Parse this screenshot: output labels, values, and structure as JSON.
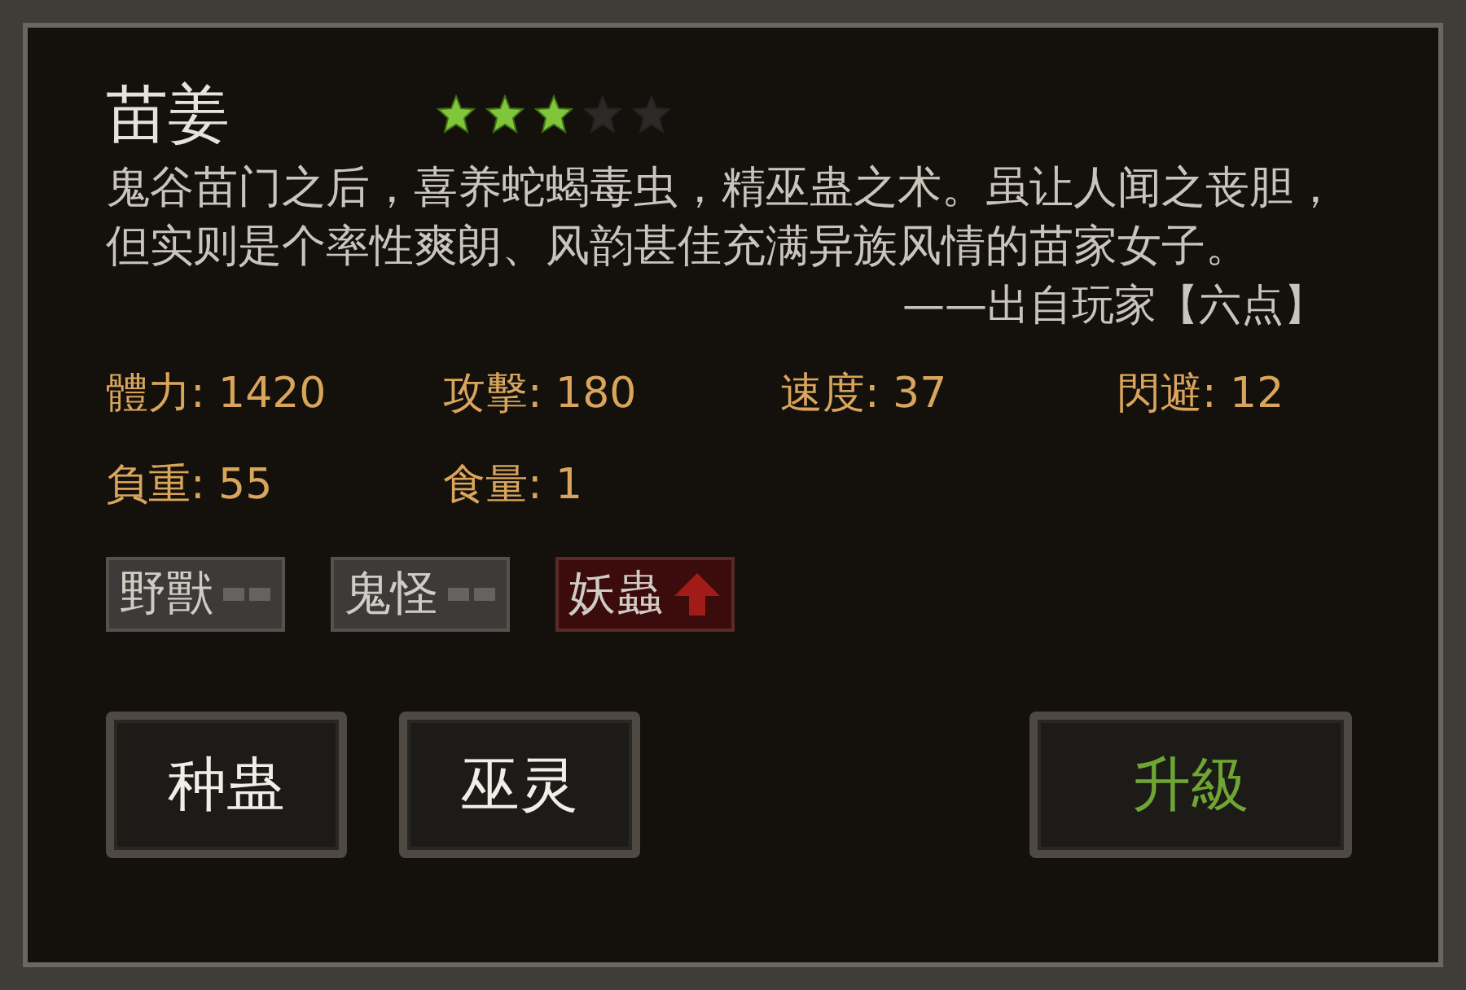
{
  "title": "苗姜",
  "stars": 3,
  "description": "鬼谷苗门之后，喜养蛇蝎毒虫，精巫蛊之术。虽让人闻之丧胆，但实则是个率性爽朗、风韵甚佳充满异族风情的苗家女子。",
  "attribution": "——出自玩家【六点】",
  "stats": [
    "體力: 1420",
    "攻擊: 180",
    "速度: 37",
    "閃避: 12",
    "負重: 55",
    "食量: 1"
  ],
  "tags": [
    {
      "label": "野獸",
      "kind": "neutral"
    },
    {
      "label": "鬼怪",
      "kind": "neutral"
    },
    {
      "label": "妖蟲",
      "kind": "up"
    }
  ],
  "buttons": [
    {
      "label": "种蛊",
      "accent": false
    },
    {
      "label": "巫灵",
      "accent": false
    },
    {
      "label": "升級",
      "accent": true
    }
  ]
}
